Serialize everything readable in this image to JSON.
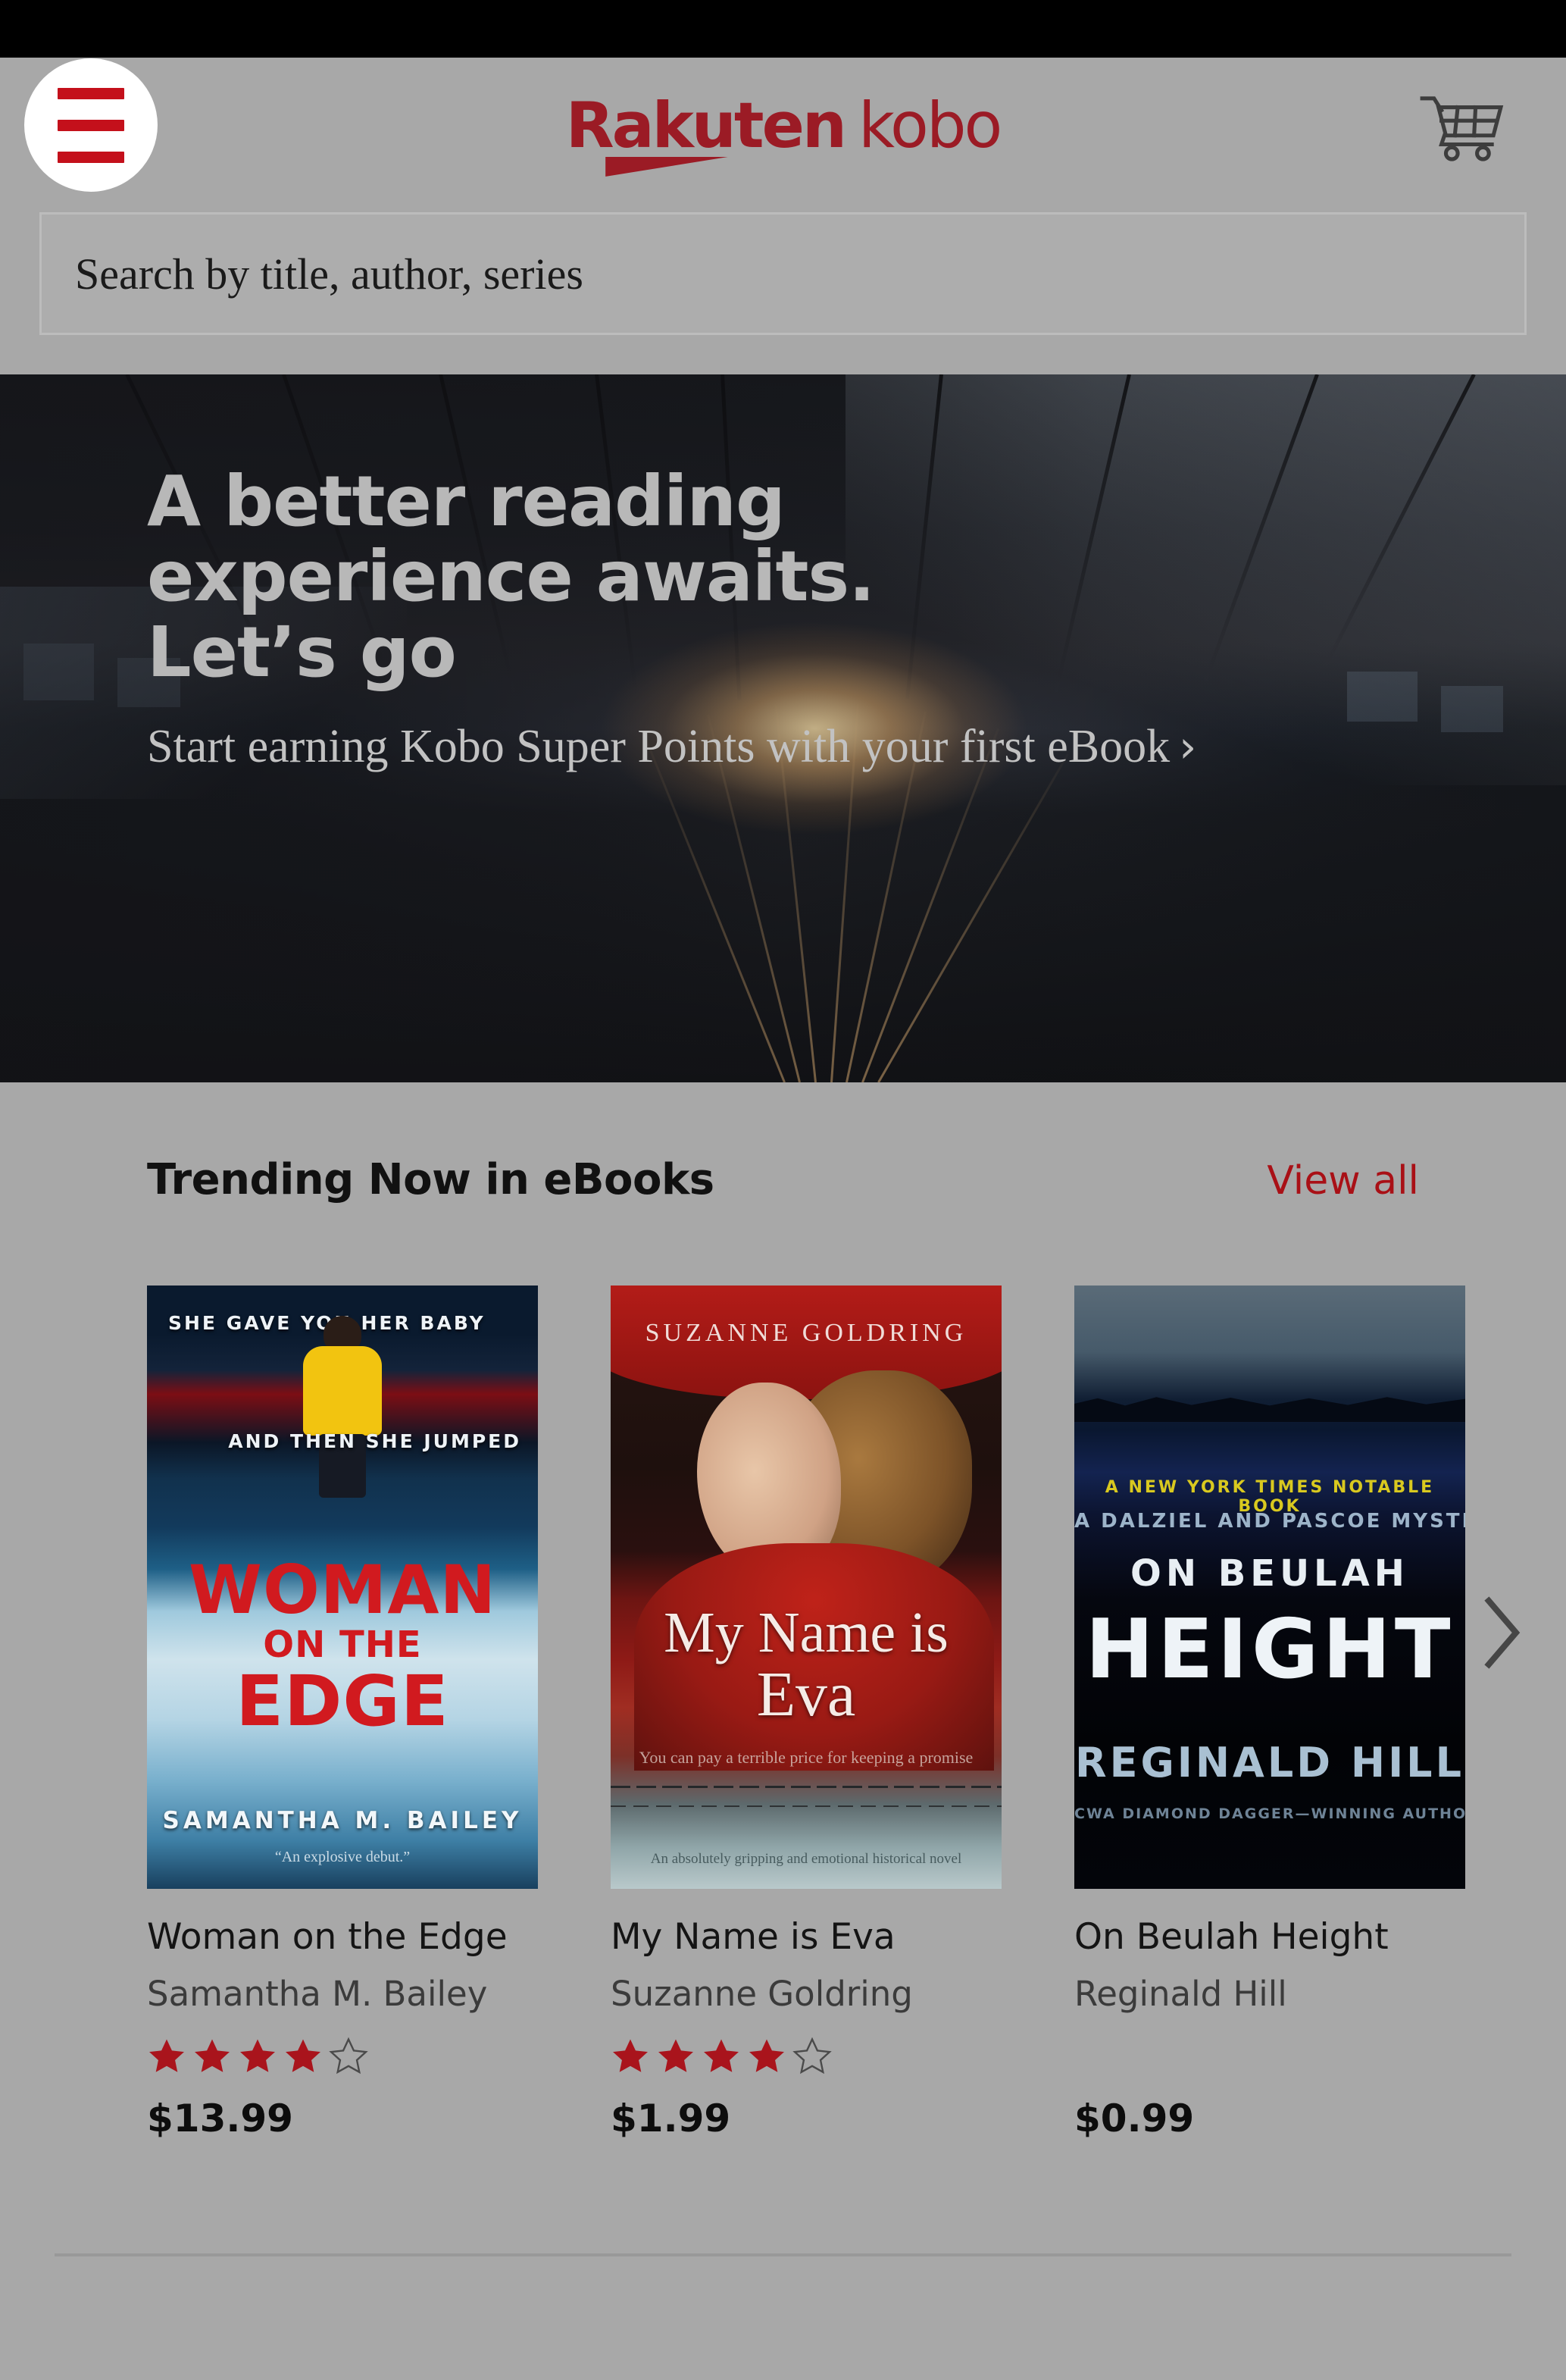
{
  "app": {
    "brand_primary": "Rakuten",
    "brand_secondary": "kobo",
    "accent_color": "#a91016",
    "background_color": "#a8a8a8"
  },
  "header": {
    "menu_icon": "hamburger-menu-icon",
    "cart_icon": "shopping-cart-icon"
  },
  "search": {
    "placeholder": "Search by title, author, series",
    "value": ""
  },
  "hero": {
    "title_line1": "A better reading",
    "title_line2": "experience awaits.",
    "title_line3": "Let’s go",
    "subtitle": "Start earning Kobo Super Points with your first eBook",
    "chevron": "›",
    "image_description": "train-station-platform-photo"
  },
  "trending": {
    "section_title": "Trending Now in eBooks",
    "view_all_label": "View all",
    "next_icon": "chevron-right-icon",
    "books": [
      {
        "title": "Woman on the Edge",
        "author": "Samantha M. Bailey",
        "price": "$13.99",
        "rating_filled": 4,
        "rating_total": 5,
        "cover": {
          "tagline_top": "SHE GAVE YOU HER BABY",
          "tagline_bottom": "AND THEN SHE JUMPED",
          "title_line1": "WOMAN",
          "title_line2": "ON THE",
          "title_line3": "EDGE",
          "author_name": "SAMANTHA M. BAILEY",
          "blurb": "“An explosive debut.”"
        }
      },
      {
        "title": "My Name is Eva",
        "author": "Suzanne Goldring",
        "price": "$1.99",
        "rating_filled": 4,
        "rating_total": 5,
        "cover": {
          "author_name": "SUZANNE GOLDRING",
          "title_line1": "My Name is",
          "title_line2": "Eva",
          "tagline": "You can pay a terrible price for keeping a promise",
          "blurb": "An absolutely gripping and emotional historical novel"
        }
      },
      {
        "title": "On Beulah Height",
        "author": "Reginald Hill",
        "price": "$0.99",
        "rating_filled": 0,
        "rating_total": 0,
        "cover": {
          "notable": "A NEW YORK TIMES NOTABLE BOOK",
          "series": "A DALZIEL AND PASCOE MYSTERY",
          "title_line1": "ON BEULAH",
          "title_line2": "HEIGHT",
          "author_name": "REGINALD HILL",
          "accolade": "CWA DIAMOND DAGGER—WINNING AUTHOR"
        }
      }
    ]
  }
}
